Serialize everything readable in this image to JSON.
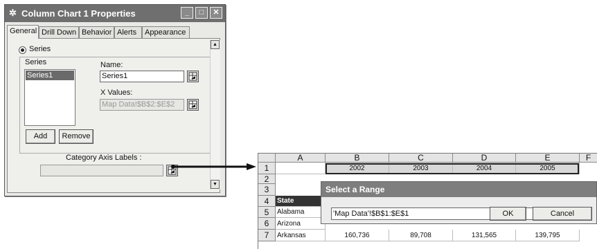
{
  "dialog": {
    "title": "Column Chart 1 Properties",
    "tabs": [
      "General",
      "Drill Down",
      "Behavior",
      "Alerts",
      "Appearance"
    ],
    "series_radio_label": "Series",
    "series_group_label": "Series",
    "series_list": [
      "Series1"
    ],
    "name_label": "Name:",
    "name_value": "Series1",
    "xvalues_label": "X Values:",
    "xvalues_value": "Map Data!$B$2:$E$2",
    "add_label": "Add",
    "remove_label": "Remove",
    "category_label": "Category Axis Labels :",
    "category_value": ""
  },
  "sheet": {
    "columns": [
      "A",
      "B",
      "C",
      "D",
      "E",
      "F"
    ],
    "rows": [
      "1",
      "2",
      "3",
      "4",
      "5",
      "6",
      "7"
    ],
    "years": [
      "2002",
      "2003",
      "2004",
      "2005"
    ],
    "state_header": "State",
    "states": [
      "Alabama",
      "Arizona",
      "Arkansas"
    ],
    "arkansas_values": [
      "160,736",
      "89,708",
      "131,565",
      "139,795"
    ]
  },
  "range_dialog": {
    "title": "Select a Range",
    "value": "'Map Data'!$B$1:$E$1",
    "ok_label": "OK",
    "cancel_label": "Cancel"
  },
  "icons": {
    "title_icon": "settings-gear-icon",
    "picker_icon": "range-picker-icon",
    "minimize": "minimize-icon",
    "maximize": "maximize-icon",
    "close": "close-icon"
  }
}
